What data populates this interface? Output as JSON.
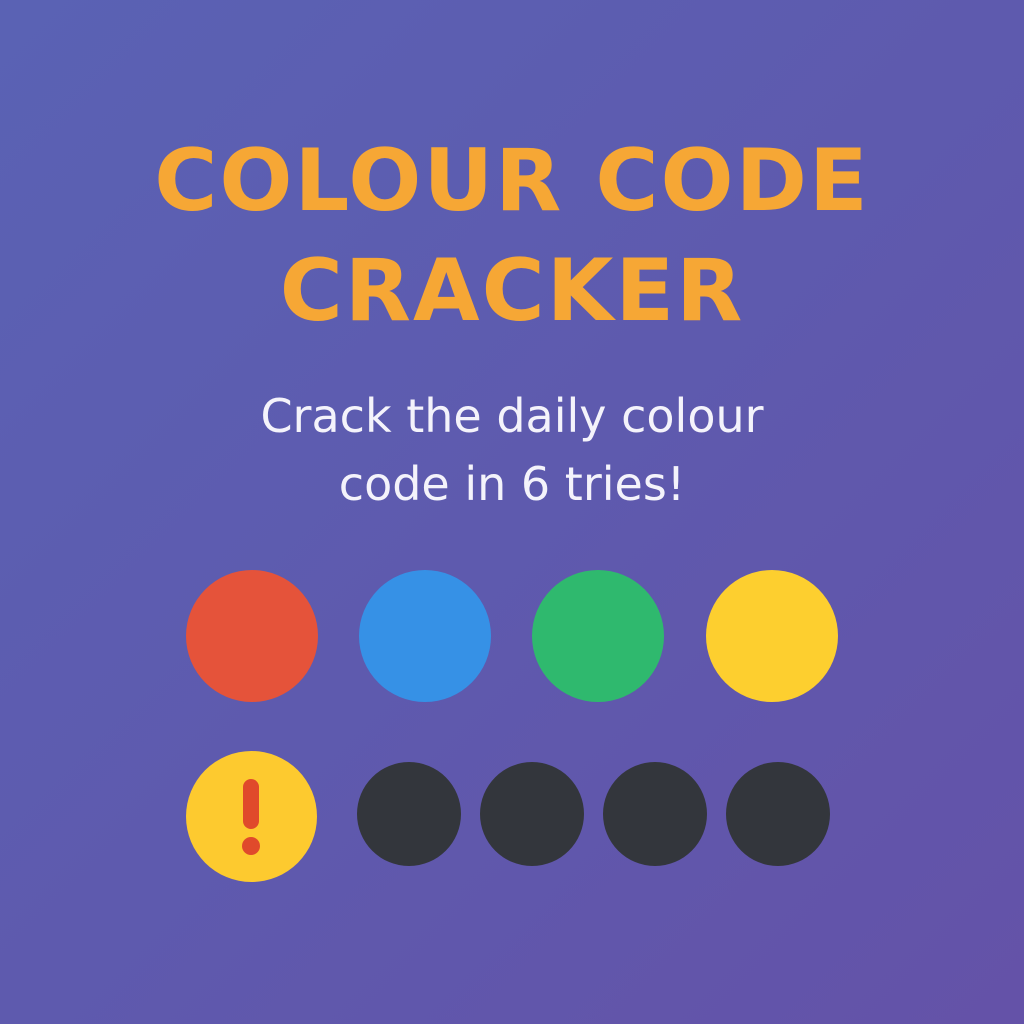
{
  "title": {
    "line1": "COLOUR CODE",
    "line2": "CRACKER"
  },
  "subtitle": {
    "line1": "Crack the daily colour",
    "line2": "code in 6 tries!"
  },
  "colors": {
    "background": "#5e5aae",
    "title": "#f6a735",
    "subtitle": "#f4f3fb",
    "hint_button": "#fdca2f",
    "hint_icon": "#e04a2b",
    "empty_slot": "#33363c"
  },
  "code_pegs": [
    {
      "name": "red",
      "color": "#e5533a"
    },
    {
      "name": "blue",
      "color": "#3691e6"
    },
    {
      "name": "green",
      "color": "#2fb96e"
    },
    {
      "name": "yellow",
      "color": "#fdcf2f"
    }
  ],
  "hint_button": {
    "icon": "exclamation-icon"
  },
  "guess_slots": {
    "empty_count": 4
  }
}
